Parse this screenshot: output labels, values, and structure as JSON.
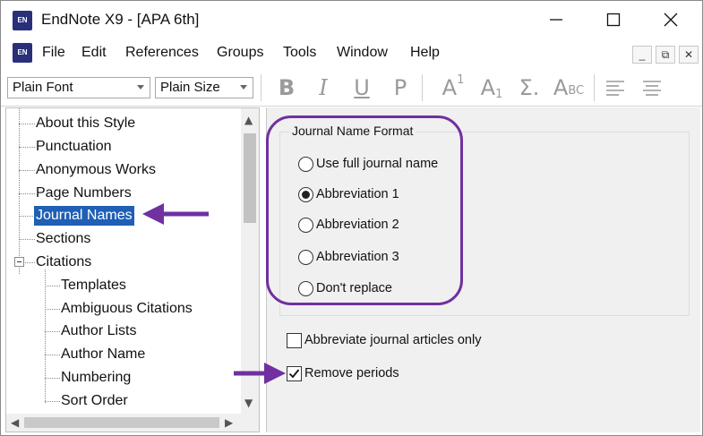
{
  "window": {
    "app_icon": "EN",
    "title": "EndNote X9 - [APA 6th]",
    "controls": {
      "minimize_icon": "minimize-icon",
      "maximize_icon": "maximize-icon",
      "close_icon": "close-icon"
    }
  },
  "menubar": {
    "app_icon": "EN",
    "items": [
      {
        "label": "File"
      },
      {
        "label": "Edit"
      },
      {
        "label": "References"
      },
      {
        "label": "Groups"
      },
      {
        "label": "Tools"
      },
      {
        "label": "Window"
      },
      {
        "label": "Help"
      }
    ],
    "mdi_controls": [
      "_",
      "⧉",
      "✕"
    ]
  },
  "toolbar": {
    "font_select": {
      "value": "Plain Font"
    },
    "size_select": {
      "value": "Plain Size"
    },
    "buttons": {
      "bold": "B",
      "italic": "I",
      "underline": "U",
      "plain": "P",
      "superscript": "A",
      "superscript_mark": "1",
      "subscript": "A",
      "subscript_mark": "1",
      "symbol": "Σ.",
      "smallcaps": "A",
      "smallcaps_mark": "BC"
    }
  },
  "tree": {
    "items": [
      {
        "label": "About this Style"
      },
      {
        "label": "Punctuation"
      },
      {
        "label": "Anonymous Works"
      },
      {
        "label": "Page Numbers"
      },
      {
        "label": "Journal Names",
        "selected": true
      },
      {
        "label": "Sections"
      },
      {
        "label": "Citations",
        "expanded": true
      },
      {
        "label": "Templates"
      },
      {
        "label": "Ambiguous Citations"
      },
      {
        "label": "Author Lists"
      },
      {
        "label": "Author Name"
      },
      {
        "label": "Numbering"
      },
      {
        "label": "Sort Order"
      }
    ]
  },
  "journal_names": {
    "group_title": "Journal Name Format",
    "options": [
      {
        "label": "Use full journal name",
        "checked": false
      },
      {
        "label": "Abbreviation 1",
        "checked": true
      },
      {
        "label": "Abbreviation 2",
        "checked": false
      },
      {
        "label": "Abbreviation 3",
        "checked": false
      },
      {
        "label": "Don't replace",
        "checked": false
      }
    ],
    "checkboxes": [
      {
        "label": "Abbreviate journal articles only",
        "checked": false
      },
      {
        "label": "Remove periods",
        "checked": true
      }
    ]
  },
  "colors": {
    "annotation": "#7030a0",
    "selection": "#1f5fb5",
    "app_icon": "#2a2f7a"
  }
}
